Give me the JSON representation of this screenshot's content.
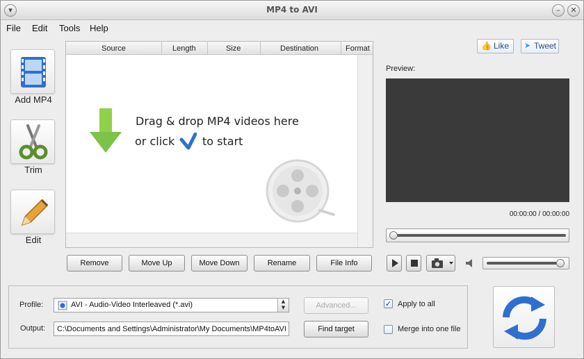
{
  "window": {
    "title": "MP4 to AVI"
  },
  "menu": [
    "File",
    "Edit",
    "Tools",
    "Help"
  ],
  "sidebar": {
    "add": "Add MP4",
    "trim": "Trim",
    "edit": "Edit"
  },
  "list": {
    "columns": [
      "Source",
      "Length",
      "Size",
      "Destination",
      "Format"
    ],
    "drop_line1": "Drag & drop MP4 videos here",
    "drop_line2_pre": "or click",
    "drop_line2_post": "to start"
  },
  "actions": [
    "Remove",
    "Move Up",
    "Move Down",
    "Rename",
    "File Info"
  ],
  "social": {
    "like": "Like",
    "tweet": "Tweet"
  },
  "preview": {
    "label": "Preview:",
    "timecode": "00:00:00 / 00:00:00"
  },
  "settings": {
    "profile_label": "Profile:",
    "profile_value": "AVI - Audio-Video Interleaved (*.avi)",
    "output_label": "Output:",
    "output_value": "C:\\Documents and Settings\\Administrator\\My Documents\\MP4toAVI",
    "advanced": "Advanced...",
    "find_target": "Find target",
    "apply_all": "Apply to all",
    "apply_all_checked": true,
    "merge": "Merge into one file",
    "merge_checked": false
  },
  "colors": {
    "accent": "#2f6fd0",
    "green": "#7cc34a",
    "preview_bg": "#3a3a3a"
  },
  "icons": {
    "add": "film-icon",
    "trim": "scissors-icon",
    "edit": "pencil-icon",
    "drop": "arrow-down-icon",
    "reel": "film-reel-icon",
    "convert": "convert-arrows-icon"
  }
}
